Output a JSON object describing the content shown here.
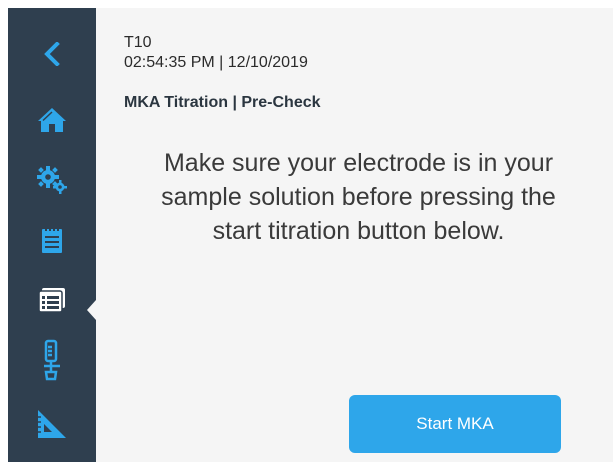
{
  "sidebar": {
    "items": [
      {
        "icon": "chevron-left-icon"
      },
      {
        "icon": "home-icon"
      },
      {
        "icon": "settings-gears-icon"
      },
      {
        "icon": "notepad-icon"
      },
      {
        "icon": "methods-list-icon",
        "active": true
      },
      {
        "icon": "electrode-icon"
      },
      {
        "icon": "ruler-triangle-icon"
      }
    ]
  },
  "header": {
    "device_id": "T10",
    "timestamp": "02:54:35 PM | 12/10/2019",
    "title": "MKA Titration | Pre-Check"
  },
  "main": {
    "instructions": "Make sure your electrode is in your sample solution before pressing the start titration button below.",
    "start_button_label": "Start MKA"
  },
  "colors": {
    "sidebar_bg": "#2f3f4f",
    "icon_blue": "#2ea6ea",
    "content_bg": "#f5f5f5",
    "button_bg": "#2ea6ea"
  }
}
